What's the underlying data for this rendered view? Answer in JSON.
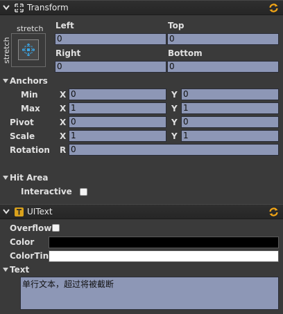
{
  "transform": {
    "title": "Transform",
    "stretch_top": "stretch",
    "stretch_side": "stretch",
    "left_label": "Left",
    "left_value": "0",
    "top_label": "Top",
    "top_value": "0",
    "right_label": "Right",
    "right_value": "0",
    "bottom_label": "Bottom",
    "bottom_value": "0",
    "anchors_label": "Anchors",
    "min_label": "Min",
    "min_x": "0",
    "min_y": "0",
    "max_label": "Max",
    "max_x": "1",
    "max_y": "1",
    "pivot_label": "Pivot",
    "pivot_x": "0",
    "pivot_y": "0",
    "scale_label": "Scale",
    "scale_x": "1",
    "scale_y": "1",
    "rotation_label": "Rotation",
    "rotation_r": "0",
    "x_axis": "X",
    "y_axis": "Y",
    "r_axis": "R"
  },
  "hit_area": {
    "label": "Hit Area",
    "interactive_label": "Interactive",
    "interactive_checked": false
  },
  "uitext": {
    "title": "UIText",
    "overflow_label": "Overflow",
    "overflow_checked": false,
    "color_label": "Color",
    "color_value": "#000000",
    "colortint_label": "ColorTint",
    "colortint_value": "#ffffff",
    "text_label": "Text",
    "text_value": "单行文本，超过将被截断"
  },
  "icons": [
    "chevron-down-icon",
    "move-arrows-icon",
    "anchor-preset-icon",
    "refresh-icon",
    "text-component-icon",
    "triangle-down-icon"
  ],
  "colors": {
    "field_bg": "#8d97b6",
    "panel_bg": "#3a3a3a",
    "header_bg": "#282828",
    "accent_orange": "#f2a516"
  }
}
